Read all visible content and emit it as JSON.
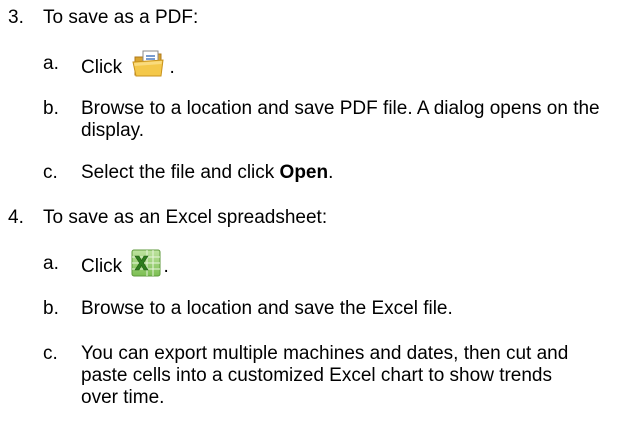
{
  "steps": [
    {
      "number": "3.",
      "text": "To save as a PDF:",
      "substeps": [
        {
          "letter": "a.",
          "text": "Click",
          "suffix": "."
        },
        {
          "letter": "b.",
          "text": "Browse to a location and save PDF file. A dialog opens on the display."
        },
        {
          "letter": "c.",
          "text_before": "Select the file and click ",
          "bold": "Open",
          "text_after": "."
        }
      ]
    },
    {
      "number": "4.",
      "text": "To save as an Excel spreadsheet:",
      "substeps": [
        {
          "letter": "a.",
          "text": "Click",
          "suffix": "."
        },
        {
          "letter": "b.",
          "text": "Browse to a location and save the Excel file."
        },
        {
          "letter": "c.",
          "text": "You can export multiple machines and dates, then cut and paste cells into a customized Excel chart to show trends over time."
        }
      ]
    }
  ],
  "icons": {
    "pdf_save": "open-folder-document-icon",
    "excel_export": "excel-spreadsheet-icon"
  }
}
